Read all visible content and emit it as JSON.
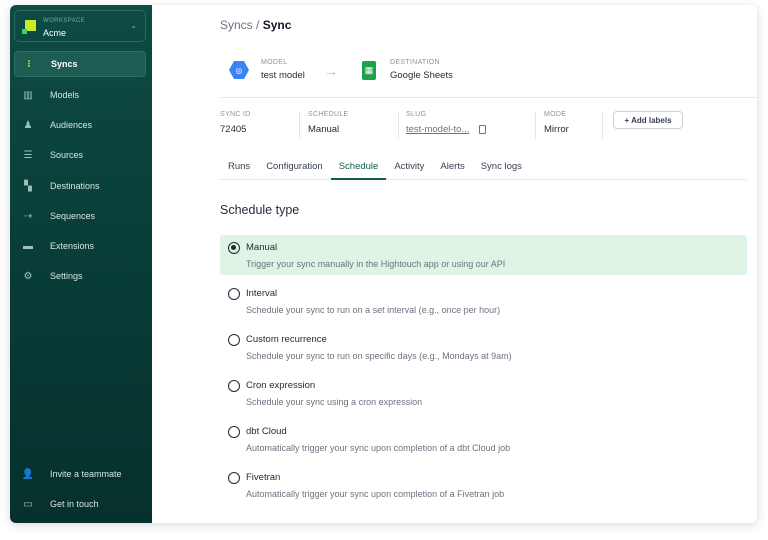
{
  "workspace": {
    "label": "WORKSPACE",
    "name": "Acme"
  },
  "nav": [
    {
      "label": "Syncs",
      "icon": "syncs-icon"
    },
    {
      "label": "Models",
      "icon": "models-icon"
    },
    {
      "label": "Audiences",
      "icon": "audiences-icon"
    },
    {
      "label": "Sources",
      "icon": "sources-icon"
    },
    {
      "label": "Destinations",
      "icon": "destinations-icon"
    },
    {
      "label": "Sequences",
      "icon": "sequences-icon"
    },
    {
      "label": "Extensions",
      "icon": "extensions-icon"
    },
    {
      "label": "Settings",
      "icon": "settings-icon"
    }
  ],
  "nav_bottom": [
    {
      "label": "Invite a teammate"
    },
    {
      "label": "Get in touch"
    }
  ],
  "breadcrumb": {
    "parent": "Syncs",
    "sep": "/",
    "current": "Sync"
  },
  "model": {
    "label": "MODEL",
    "value": "test model"
  },
  "destination": {
    "label": "DESTINATION",
    "value": "Google Sheets"
  },
  "meta": {
    "sync_id": {
      "label": "SYNC ID",
      "value": "72405"
    },
    "schedule": {
      "label": "SCHEDULE",
      "value": "Manual"
    },
    "slug": {
      "label": "SLUG",
      "value": "test-model-to..."
    },
    "mode": {
      "label": "MODE",
      "value": "Mirror"
    }
  },
  "add_labels": "+ Add labels",
  "tabs": [
    "Runs",
    "Configuration",
    "Schedule",
    "Activity",
    "Alerts",
    "Sync logs"
  ],
  "schedule_title": "Schedule type",
  "options": [
    {
      "title": "Manual",
      "desc": "Trigger your sync manually in the Hightouch app or using our API",
      "selected": true
    },
    {
      "title": "Interval",
      "desc": "Schedule your sync to run on a set interval (e.g., once per hour)"
    },
    {
      "title": "Custom recurrence",
      "desc": "Schedule your sync to run on specific days (e.g., Mondays at 9am)"
    },
    {
      "title": "Cron expression",
      "desc": "Schedule your sync using a cron expression"
    },
    {
      "title": "dbt Cloud",
      "desc": "Automatically trigger your sync upon completion of a dbt Cloud job"
    },
    {
      "title": "Fivetran",
      "desc": "Automatically trigger your sync upon completion of a Fivetran job"
    }
  ]
}
